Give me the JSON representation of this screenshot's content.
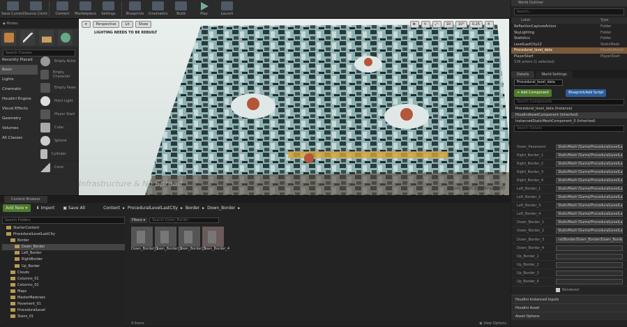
{
  "toolbar": {
    "buttons": [
      "Save Current",
      "Source Control",
      "Content",
      "Marketplace",
      "Settings",
      "Blueprints",
      "Cinematics",
      "Build",
      "Play",
      "Launch"
    ],
    "icons": [
      "save-icon",
      "source-control-icon",
      "content-icon",
      "marketplace-icon",
      "settings-icon",
      "blueprints-icon",
      "cinematics-icon",
      "build-icon",
      "play-icon",
      "launch-icon"
    ]
  },
  "modes": {
    "search_placeholder": "Search Classes",
    "categories": [
      "Recently Placed",
      "Basic",
      "Lights",
      "Cinematic",
      "Houdini Engine",
      "Visual Effects",
      "Geometry",
      "Volumes",
      "All Classes"
    ],
    "assets": [
      "Empty Actor",
      "Empty Character",
      "Empty Pawn",
      "Point Light",
      "Player Start",
      "Cube",
      "Sphere",
      "Cylinder",
      "Cone"
    ]
  },
  "viewport": {
    "perspective": "Perspective",
    "lit": "Lit",
    "show": "Show",
    "message": "LIGHTING NEEDS TO BE REBUILT",
    "level_label": "Level: LastCity (Persistent)",
    "snap_angle": "10°",
    "grid": "10",
    "scale": "0.25",
    "camera_speed": "4",
    "watermark": "Infrastructure & No Spread"
  },
  "outliner": {
    "tab": "World Outliner",
    "search_placeholder": "Search...",
    "col_label": "Label",
    "col_type": "Type",
    "rows": [
      {
        "label": "ReflectionCaptureActors",
        "type": "Folder",
        "sel": false
      },
      {
        "label": "SkyLighting",
        "type": "Folder",
        "sel": false
      },
      {
        "label": "Statistics",
        "type": "Folder",
        "sel": false
      },
      {
        "label": "LevelLastCity12",
        "type": "StaticMesh",
        "sel": false
      },
      {
        "label": "Procedural_level_data",
        "type": "HoudiniAsset",
        "sel": true
      },
      {
        "label": "PlayerStart",
        "type": "PlayerStart",
        "sel": false
      }
    ],
    "footer": "136 actors (1 selected)"
  },
  "details": {
    "tabs": [
      "Details",
      "World Settings"
    ],
    "name_value": "Procedural_level_data",
    "add_component": "+ Add Component",
    "blueprint": "Blueprint/Add Script",
    "search_components": "Search Components",
    "components": [
      "Procedural_level_data (Instance)",
      "HoudiniAssetComponent (Inherited)",
      "InstancedStaticMeshComponent_0 (Inherited)"
    ],
    "search_details": "Search Details",
    "properties": [
      {
        "k": "Down_Pavement",
        "v": "StaticMesh'/Game/ProceduralLevelLast"
      },
      {
        "k": "Right_Border_1",
        "v": "StaticMesh'/Game/ProceduralLevelLast"
      },
      {
        "k": "Right_Border_2",
        "v": "StaticMesh'/Game/ProceduralLevelLast"
      },
      {
        "k": "Right_Border_3",
        "v": "StaticMesh'/Game/ProceduralLevelLast"
      },
      {
        "k": "Right_Border_4",
        "v": "StaticMesh'/Game/ProceduralLevelLast"
      },
      {
        "k": "Left_Border_1",
        "v": "StaticMesh'/Game/ProceduralLevelLast"
      },
      {
        "k": "Left_Border_2",
        "v": "StaticMesh'/Game/ProceduralLevelLast"
      },
      {
        "k": "Left_Border_3",
        "v": "StaticMesh'/Game/ProceduralLevelLast"
      },
      {
        "k": "Left_Border_4",
        "v": "StaticMesh'/Game/ProceduralLevelLast"
      },
      {
        "k": "Down_Border_1",
        "v": "StaticMesh'/Game/ProceduralLevelLast"
      },
      {
        "k": "Down_Border_2",
        "v": "StaticMesh'/Game/ProceduralLevelLast"
      },
      {
        "k": "Down_Border_3",
        "v": "ral/Border/Down_Border/Down_Border_3"
      },
      {
        "k": "Down_Border_4",
        "v": ""
      },
      {
        "k": "Up_Border_1",
        "v": ""
      },
      {
        "k": "Up_Border_2",
        "v": ""
      },
      {
        "k": "Up_Border_3",
        "v": ""
      },
      {
        "k": "Up_Border_4",
        "v": ""
      }
    ],
    "checkbox_label": "Rendered",
    "sections": [
      "Houdini Instanced Inputs",
      "Houdini Asset",
      "Asset Options"
    ]
  },
  "content_browser": {
    "tab": "Content Browser",
    "add_new": "Add New",
    "import": "Import",
    "save_all": "Save All",
    "crumbs": [
      "Content",
      "ProceduralLevelLastCity",
      "Border",
      "Down_Border"
    ],
    "search_folders": "Search Folders",
    "tree": [
      {
        "label": "StarterContent",
        "indent": 1,
        "sel": false
      },
      {
        "label": "ProceduralLevelLastCity",
        "indent": 1,
        "sel": false
      },
      {
        "label": "Border",
        "indent": 2,
        "sel": false
      },
      {
        "label": "Down_Border",
        "indent": 3,
        "sel": true
      },
      {
        "label": "Left_Border",
        "indent": 3,
        "sel": false
      },
      {
        "label": "RightBorder",
        "indent": 3,
        "sel": false
      },
      {
        "label": "Up_Border",
        "indent": 3,
        "sel": false
      },
      {
        "label": "Clouds",
        "indent": 2,
        "sel": false
      },
      {
        "label": "Columns_01",
        "indent": 2,
        "sel": false
      },
      {
        "label": "Columns_02",
        "indent": 2,
        "sel": false
      },
      {
        "label": "Maps",
        "indent": 2,
        "sel": false
      },
      {
        "label": "MasterMaterials",
        "indent": 2,
        "sel": false
      },
      {
        "label": "Pavement_01",
        "indent": 2,
        "sel": false
      },
      {
        "label": "ProceduralLevel",
        "indent": 2,
        "sel": false
      },
      {
        "label": "Stairs_01",
        "indent": 2,
        "sel": false
      }
    ],
    "filters": "Filters",
    "search_asset": "Search Down_Border",
    "assets": [
      "Down_Border_1",
      "Down_Border_2",
      "Down_Border_3",
      "Down_Border_4"
    ],
    "item_count": "4 items",
    "view_options": "View Options"
  }
}
